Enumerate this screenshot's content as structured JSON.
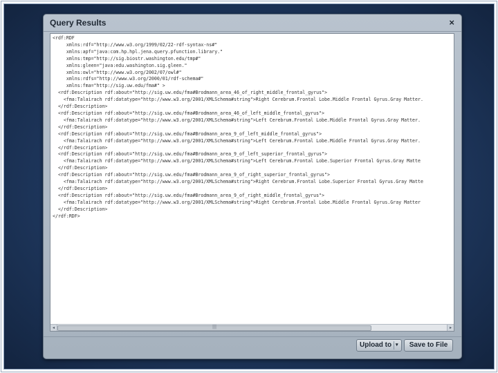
{
  "dialog": {
    "title": "Query Results",
    "close_glyph": "×"
  },
  "results": {
    "lines": [
      "<rdf:RDF",
      "     xmlns:rdf=\"http://www.w3.org/1999/02/22-rdf-syntax-ns#\"",
      "     xmlns:apf=\"java:com.hp.hpl.jena.query.pfunction.library.\"",
      "     xmlns:tmp=\"http://sig.biostr.washington.edu/tmp#\"",
      "     xmlns:gleen=\"java:edu.washington.sig.gleen.\"",
      "     xmlns:owl=\"http://www.w3.org/2002/07/owl#\"",
      "     xmlns:rdfs=\"http://www.w3.org/2000/01/rdf-schema#\"",
      "     xmlns:fma=\"http://sig.uw.edu/fma#\" >",
      "  <rdf:Description rdf:about=\"http://sig.uw.edu/fma#Brodmann_area_46_of_right_middle_frontal_gyrus\">",
      "    <fma:Talairach rdf:datatype=\"http://www.w3.org/2001/XMLSchema#string\">Right Cerebrum.Frontal Lobe.Middle Frontal Gyrus.Gray Matter.",
      "  </rdf:Description>",
      "  <rdf:Description rdf:about=\"http://sig.uw.edu/fma#Brodmann_area_46_of_left_middle_frontal_gyrus\">",
      "    <fma:Talairach rdf:datatype=\"http://www.w3.org/2001/XMLSchema#string\">Left Cerebrum.Frontal Lobe.Middle Frontal Gyrus.Gray Matter.",
      "  </rdf:Description>",
      "  <rdf:Description rdf:about=\"http://sig.uw.edu/fma#Brodmann_area_9_of_left_middle_frontal_gyrus\">",
      "    <fma:Talairach rdf:datatype=\"http://www.w3.org/2001/XMLSchema#string\">Left Cerebrum.Frontal Lobe.Middle Frontal Gyrus.Gray Matter.",
      "  </rdf:Description>",
      "  <rdf:Description rdf:about=\"http://sig.uw.edu/fma#Brodmann_area_9_of_left_superior_frontal_gyrus\">",
      "    <fma:Talairach rdf:datatype=\"http://www.w3.org/2001/XMLSchema#string\">Left Cerebrum.Frontal Lobe.Superior Frontal Gyrus.Gray Matte",
      "  </rdf:Description>",
      "  <rdf:Description rdf:about=\"http://sig.uw.edu/fma#Brodmann_area_9_of_right_superior_frontal_gyrus\">",
      "    <fma:Talairach rdf:datatype=\"http://www.w3.org/2001/XMLSchema#string\">Right Cerebrum.Frontal Lobe.Superior Frontal Gyrus.Gray Matte",
      "  </rdf:Description>",
      "  <rdf:Description rdf:about=\"http://sig.uw.edu/fma#Brodmann_area_9_of_right_middle_frontal_gyrus\">",
      "    <fma:Talairach rdf:datatype=\"http://www.w3.org/2001/XMLSchema#string\">Right Cerebrum.Frontal Lobe.Middle Frontal Gyrus.Gray Matter",
      "  </rdf:Description>",
      "</rdf:RDF>"
    ]
  },
  "scrollbar": {
    "left_arrow": "◂",
    "right_arrow": "▸",
    "grip": "|||"
  },
  "buttons": {
    "upload_label": "Upload to",
    "upload_caret": "▾",
    "save_label": "Save to File"
  }
}
